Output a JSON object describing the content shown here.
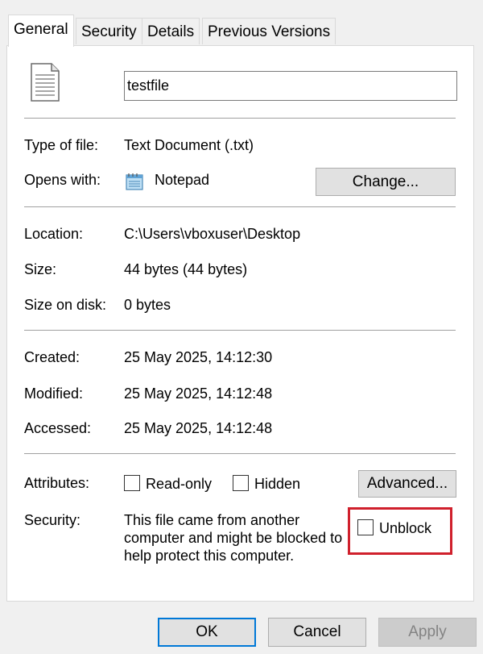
{
  "tabs": [
    {
      "label": "General",
      "active": true
    },
    {
      "label": "Security",
      "active": false
    },
    {
      "label": "Details",
      "active": false
    },
    {
      "label": "Previous Versions",
      "active": false
    }
  ],
  "file": {
    "name": "testfile",
    "icon": "text-file-icon"
  },
  "type": {
    "label": "Type of file:",
    "value": "Text Document (.txt)"
  },
  "opens_with": {
    "label": "Opens with:",
    "app_icon": "notepad-icon",
    "app": "Notepad",
    "change_button": "Change..."
  },
  "location": {
    "label": "Location:",
    "value": "C:\\Users\\vboxuser\\Desktop"
  },
  "size": {
    "label": "Size:",
    "value": "44 bytes (44 bytes)"
  },
  "size_on_disk": {
    "label": "Size on disk:",
    "value": "0 bytes"
  },
  "created": {
    "label": "Created:",
    "value": "25 May 2025, 14:12:30"
  },
  "modified": {
    "label": "Modified:",
    "value": "25 May 2025, 14:12:48"
  },
  "accessed": {
    "label": "Accessed:",
    "value": "25 May 2025, 14:12:48"
  },
  "attributes": {
    "label": "Attributes:",
    "readonly_label": "Read-only",
    "readonly_checked": false,
    "hidden_label": "Hidden",
    "hidden_checked": false,
    "advanced_button": "Advanced..."
  },
  "security": {
    "label": "Security:",
    "message": "This file came from another\ncomputer and might be blocked to\nhelp protect this computer.",
    "unblock_label": "Unblock",
    "unblock_checked": false,
    "highlight_color": "#d0202c"
  },
  "footer": {
    "ok": "OK",
    "cancel": "Cancel",
    "apply": "Apply",
    "apply_enabled": false
  },
  "colors": {
    "dialog_bg": "#f0f0f0",
    "panel_bg": "#ffffff",
    "button_bg": "#e1e1e1",
    "focus_border": "#0078d7"
  }
}
